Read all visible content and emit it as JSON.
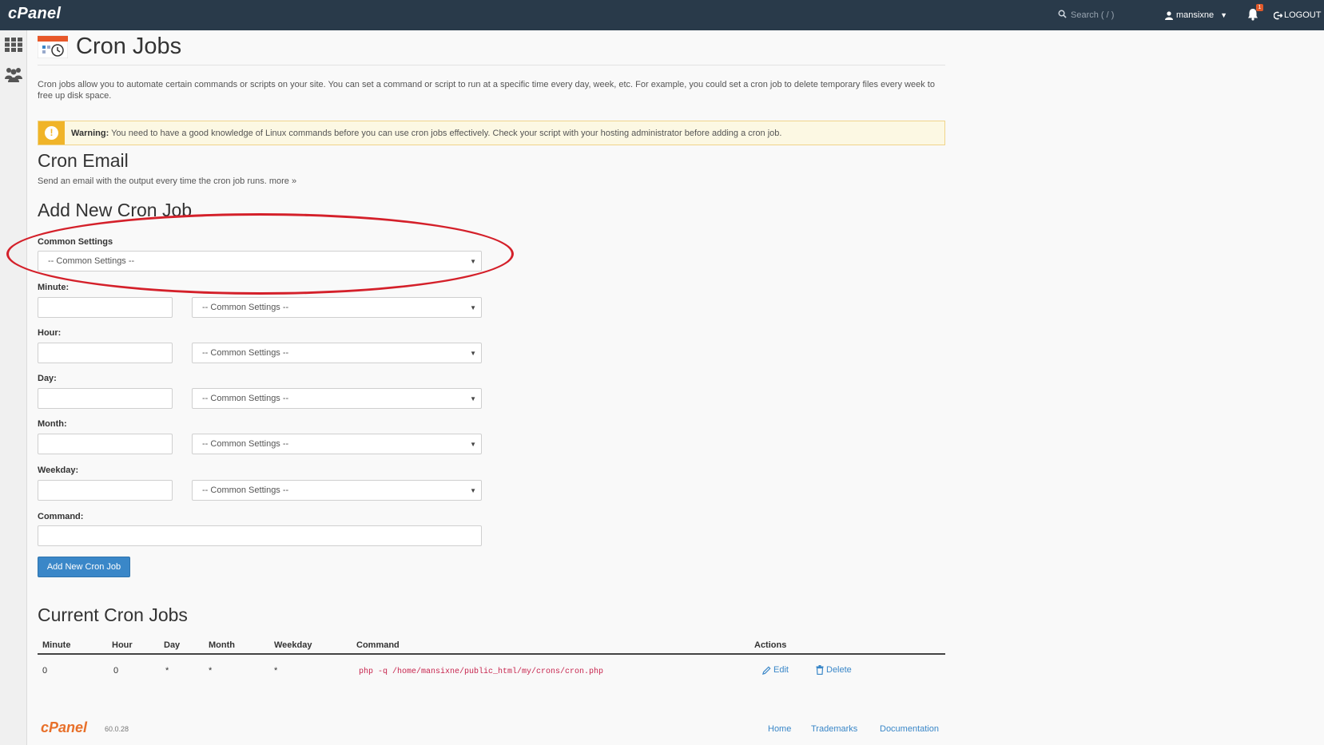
{
  "topbar": {
    "logo_text": "cPanel",
    "search_placeholder": "Search ( / )",
    "username": "mansixne",
    "notification_count": "1",
    "logout_label": "LOGOUT"
  },
  "page": {
    "title": "Cron Jobs",
    "description": "Cron jobs allow you to automate certain commands or scripts on your site. You can set a command or script to run at a specific time every day, week, etc. For example, you could set a cron job to delete temporary files every week to free up disk space.",
    "warning_bold": "Warning:",
    "warning_text": " You need to have a good knowledge of Linux commands before you can use cron jobs effectively. Check your script with your hosting administrator before adding a cron job."
  },
  "cron_email": {
    "heading": "Cron Email",
    "subtext": "Send an email with the output every time the cron job runs.",
    "more_link": "more »"
  },
  "add_cron": {
    "heading": "Add New Cron Job",
    "common_settings_label": "Common Settings",
    "common_settings_value": "-- Common Settings --",
    "fields": [
      {
        "label": "Minute:",
        "select_value": "-- Common Settings --"
      },
      {
        "label": "Hour:",
        "select_value": "-- Common Settings --"
      },
      {
        "label": "Day:",
        "select_value": "-- Common Settings --"
      },
      {
        "label": "Month:",
        "select_value": "-- Common Settings --"
      },
      {
        "label": "Weekday:",
        "select_value": "-- Common Settings --"
      }
    ],
    "command_label": "Command:",
    "submit_label": "Add New Cron Job"
  },
  "current_jobs": {
    "heading": "Current Cron Jobs",
    "columns": [
      "Minute",
      "Hour",
      "Day",
      "Month",
      "Weekday",
      "Command",
      "Actions"
    ],
    "rows": [
      {
        "minute": "0",
        "hour": "0",
        "day": "*",
        "month": "*",
        "weekday": "*",
        "command": "php -q /home/mansixne/public_html/my/crons/cron.php",
        "edit": "Edit",
        "delete": "Delete"
      }
    ]
  },
  "footer": {
    "logo_text": "cPanel",
    "version": "60.0.28",
    "links": [
      "Home",
      "Trademarks",
      "Documentation"
    ]
  },
  "colors": {
    "topbar": "#293a4a",
    "primary": "#3a87c8",
    "warning": "#f0b429",
    "highlight": "#d4202a"
  }
}
